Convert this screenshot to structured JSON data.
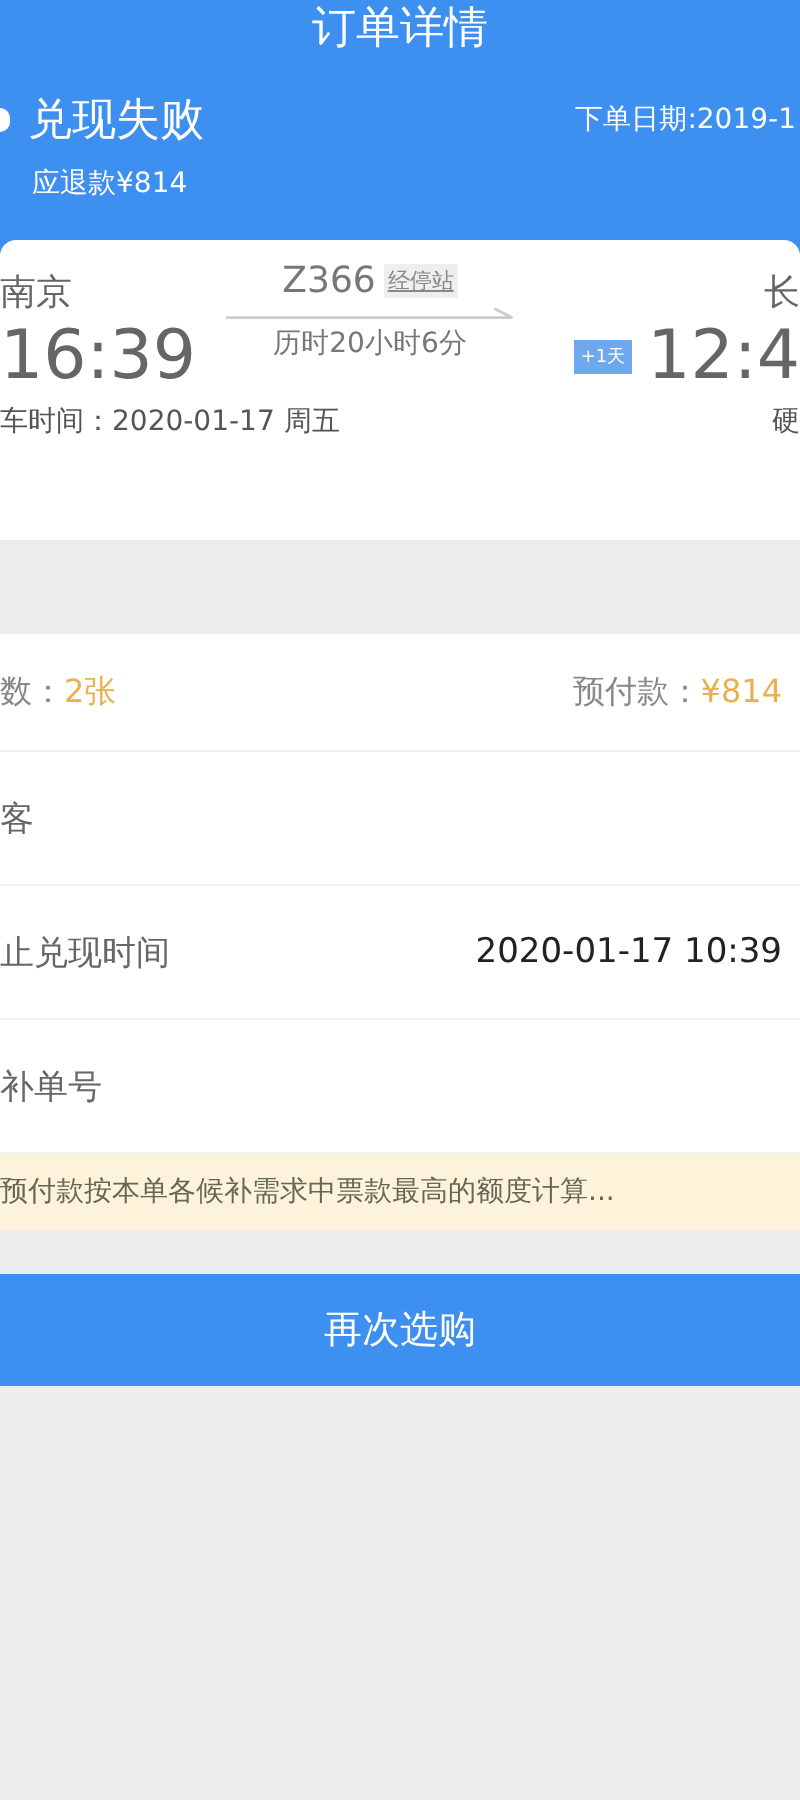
{
  "header": {
    "title": "订单详情",
    "status": "兑现失败",
    "order_date": "下单日期:2019-1",
    "refund": "应退款¥814"
  },
  "trip": {
    "from_station": "南京",
    "depart_time": "16:39",
    "board_date": "车时间：2020-01-17 周五",
    "train_no": "Z366",
    "stops_tag": "经停站",
    "duration": "历时20小时6分",
    "next_day_tag": "+1天",
    "to_station": "长",
    "arrive_time": "12:4",
    "seat_type": "硬"
  },
  "summary": [
    {
      "label": "数：",
      "value": "2张"
    },
    {
      "label": "预付款：",
      "value": "¥814"
    }
  ],
  "rows": [
    {
      "label": "客"
    },
    {
      "label": "止兑现时间",
      "value": "2020-01-17 10:39"
    },
    {
      "label": "补单号"
    }
  ],
  "notice": "预付款按本单各候补需求中票款最高的额度计算...",
  "action_button": "再次选购"
}
